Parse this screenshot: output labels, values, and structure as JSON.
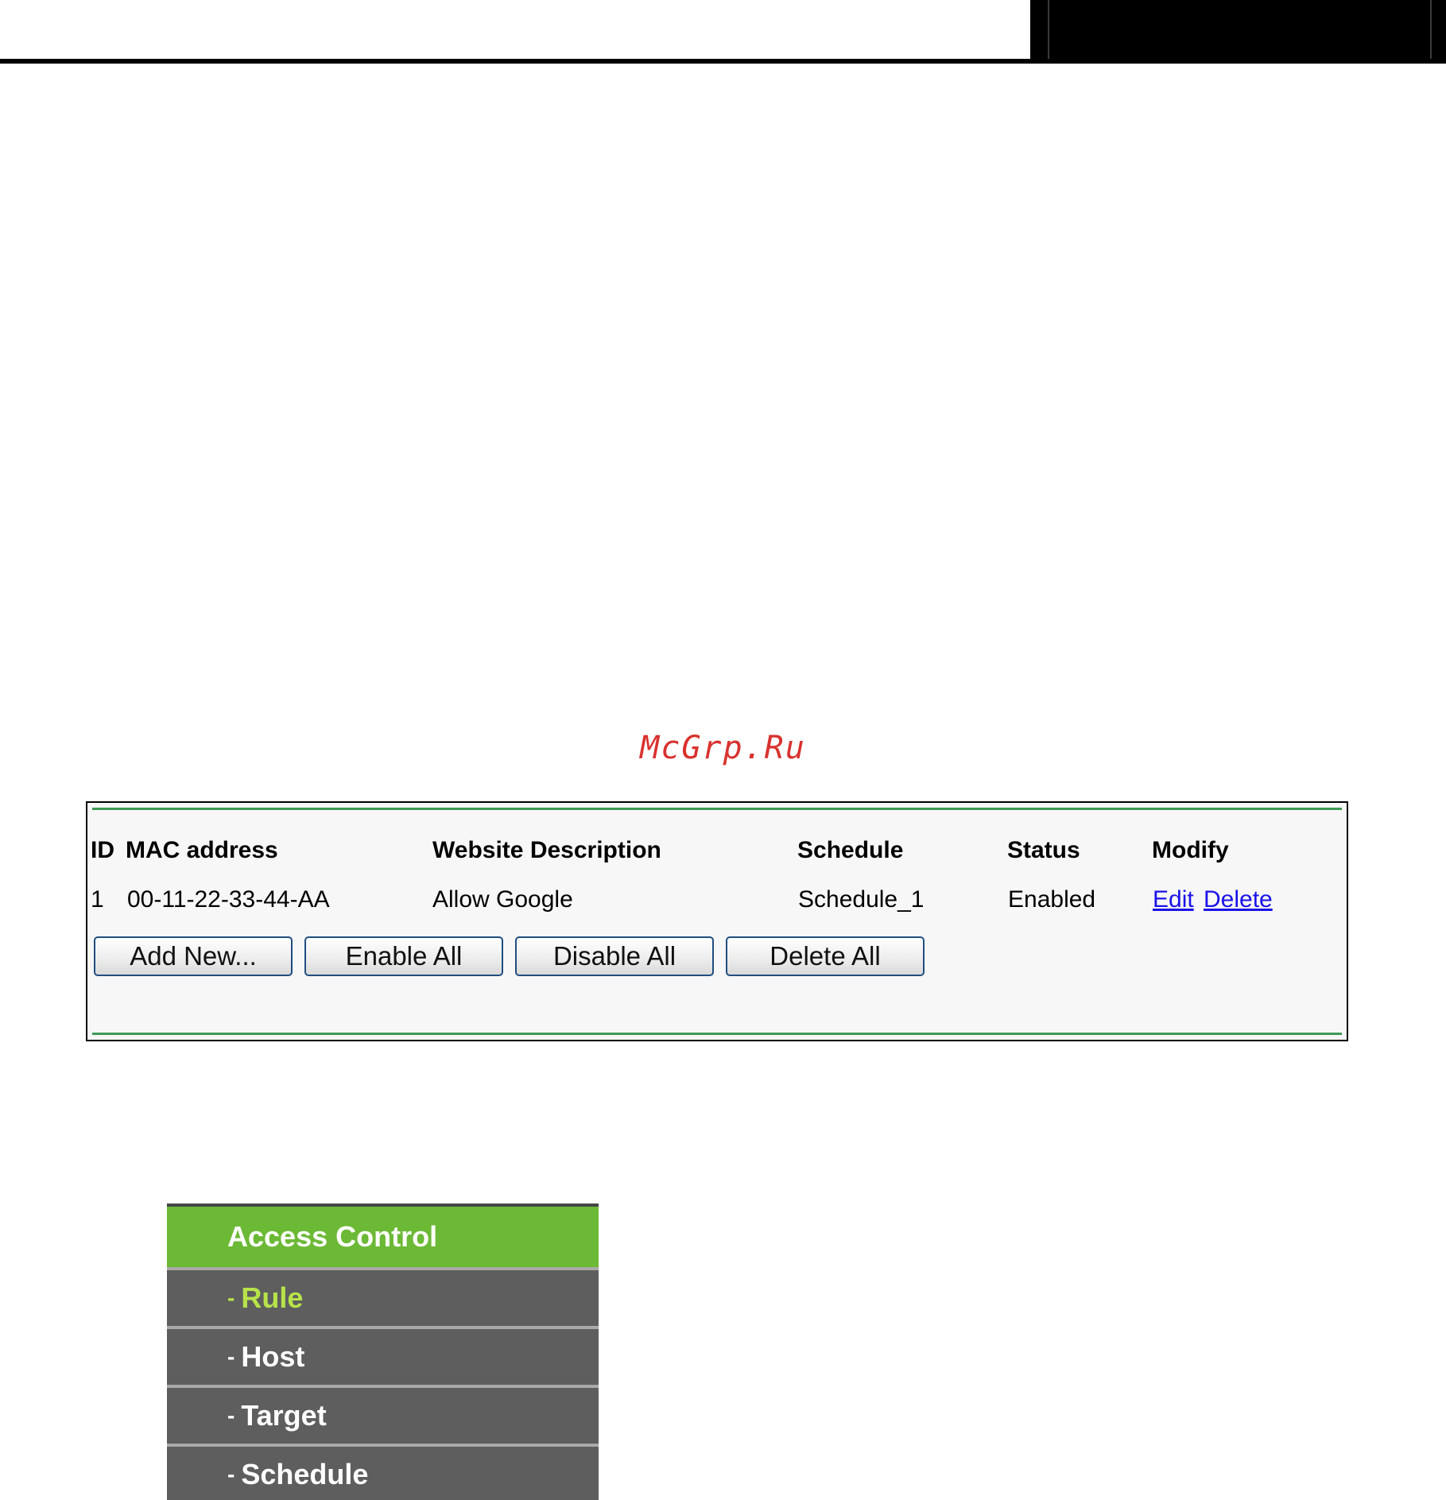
{
  "watermark": "McGrp.Ru",
  "rules_table": {
    "columns": [
      "ID",
      "MAC address",
      "Website Description",
      "Schedule",
      "Status",
      "Modify"
    ],
    "rows": [
      {
        "id": "1",
        "mac": "00-11-22-33-44-AA",
        "description": "Allow Google",
        "schedule": "Schedule_1",
        "status": "Enabled",
        "edit_label": "Edit",
        "delete_label": "Delete"
      }
    ],
    "buttons": {
      "add_new": "Add New...",
      "enable_all": "Enable All",
      "disable_all": "Disable All",
      "delete_all": "Delete All"
    }
  },
  "menu": {
    "header": "Access Control",
    "items": [
      {
        "dash": "-",
        "label": "Rule"
      },
      {
        "dash": "-",
        "label": "Host"
      },
      {
        "dash": "-",
        "label": "Target"
      },
      {
        "dash": "-",
        "label": "Schedule"
      }
    ]
  },
  "colors": {
    "menu_header": "#6cb936",
    "menu_bg": "#5e5e5e",
    "menu_active_text": "#b7e34a",
    "panel_rule": "#3e9a55",
    "link": "#1a12e8",
    "watermark": "#d8322f"
  }
}
